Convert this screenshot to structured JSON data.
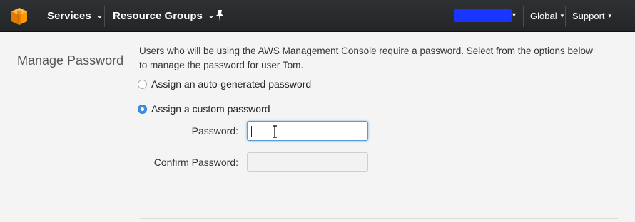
{
  "topbar": {
    "logo_icon": "aws-cube-icon",
    "services_label": "Services",
    "resource_groups_label": "Resource Groups",
    "pin_icon": "pin-icon",
    "account_caret": "▾",
    "region_label": "Global",
    "support_label": "Support",
    "caret": "⌄"
  },
  "section": {
    "label": "Manage Password"
  },
  "main": {
    "description": "Users who will be using the AWS Management Console require a password. Select from the options below to manage the password for user Tom.",
    "options": [
      {
        "label": "Assign an auto-generated password",
        "checked": false
      },
      {
        "label": "Assign a custom password",
        "checked": true
      }
    ],
    "password_label": "Password:",
    "password_value": "",
    "confirm_label": "Confirm Password:",
    "confirm_value": ""
  },
  "colors": {
    "topbar": "#232527",
    "accent": "#3b8fe5",
    "account_redaction": "#1a35ff",
    "logo": "#f90"
  }
}
